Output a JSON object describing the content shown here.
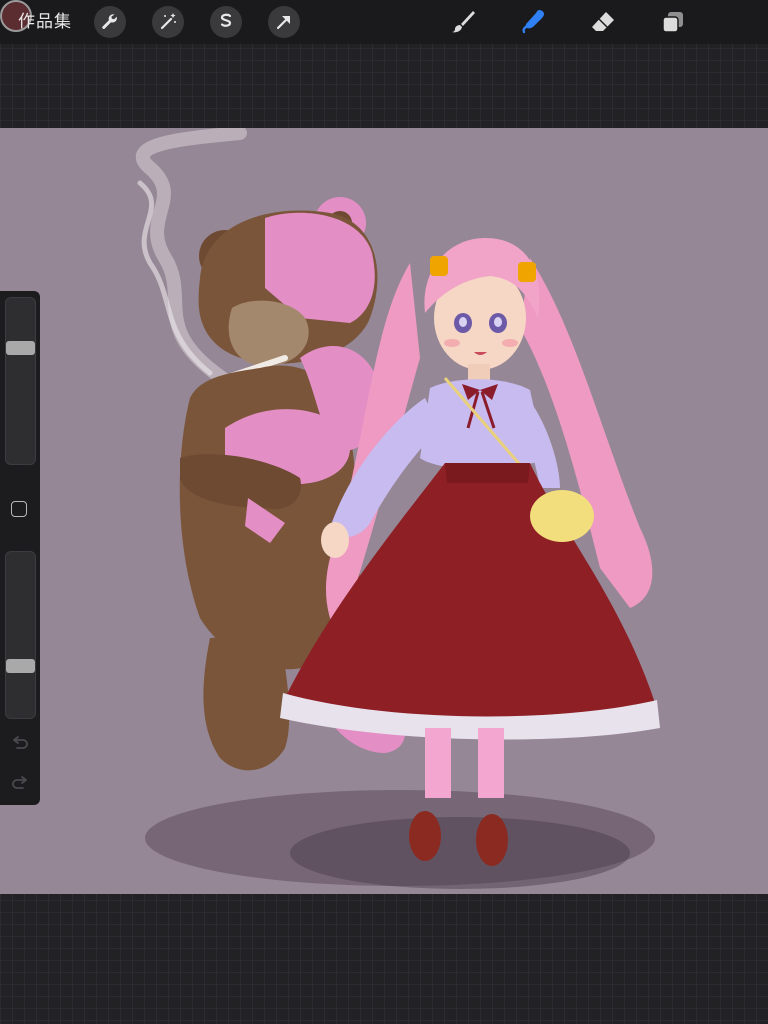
{
  "app": {
    "gallery_label": "作品集"
  },
  "toolbar": {
    "left_tools": [
      "wrench-icon",
      "magic-wand-icon",
      "selection-icon",
      "transform-arrow-icon"
    ],
    "right_tools": [
      "brush-icon",
      "smudge-icon",
      "eraser-icon",
      "layers-icon"
    ],
    "active_tool": "smudge",
    "current_color": "#5c2d30",
    "accent_color": "#2f80f5"
  },
  "sidebar": {
    "brush_size_level": 0.2,
    "opacity_level": 0.8,
    "undo_icon": "undo-icon",
    "redo_icon": "redo-icon"
  },
  "canvas": {
    "background_color": "#958795",
    "content": "illustration-girl-with-teddy-bear"
  }
}
